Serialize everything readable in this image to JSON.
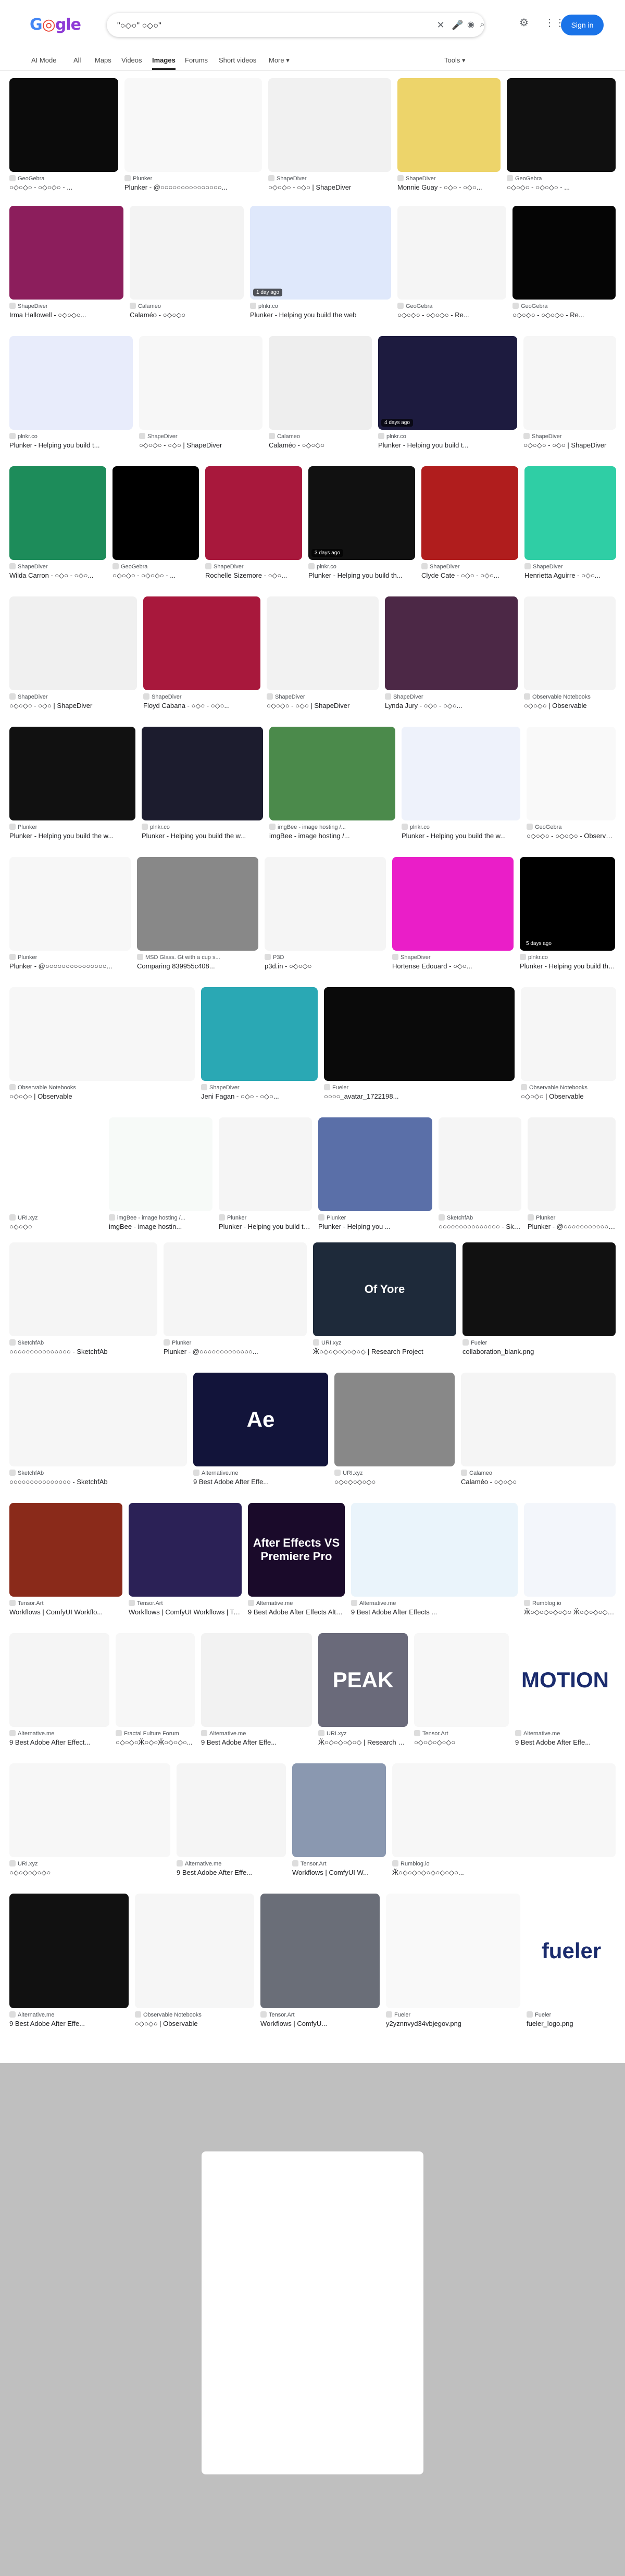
{
  "header": {
    "logo": "Google",
    "query": "\"○◇○\" ○◇○\"",
    "sign_in": "Sign in"
  },
  "tabs": [
    {
      "label": "AI Mode"
    },
    {
      "label": "All"
    },
    {
      "label": "Maps"
    },
    {
      "label": "Videos"
    },
    {
      "label": "Images",
      "active": true
    },
    {
      "label": "Forums"
    },
    {
      "label": "Short videos"
    },
    {
      "label": "More ▾"
    }
  ],
  "tools_label": "Tools ▾",
  "colors": {
    "accent": "#1a73e8",
    "magenta": "#ea1ec8",
    "crimson": "#a8183c",
    "teal": "#2fcea5",
    "dark": "#0b0b0b",
    "plum": "#4c2846",
    "yellow": "#edd46a"
  },
  "results": [
    {
      "src": "GeoGebra",
      "title": "○◇○◇○ - ○◇○◇○ - ..."
    },
    {
      "src": "Plunker",
      "title": "Plunker - @○○○○○○○○○○○○○○○..."
    },
    {
      "src": "ShapeDiver",
      "title": "○◇○◇○ - ○◇○ | ShapeDiver"
    },
    {
      "src": "ShapeDiver",
      "title": "Monnie Guay - ○◇○ - ○◇○..."
    },
    {
      "src": "GeoGebra",
      "title": "○◇○◇○ - ○◇○◇○ - ..."
    },
    {
      "src": "ShapeDiver",
      "title": "Irma Hallowell - ○◇○◇○..."
    },
    {
      "src": "Calameo",
      "title": "Calaméo - ○◇○◇○"
    },
    {
      "src": "plnkr.co",
      "title": "Plunker - Helping you build the web",
      "badge": "1 day ago"
    },
    {
      "src": "GeoGebra",
      "title": "○◇○◇○ - ○◇○◇○ - Re..."
    },
    {
      "src": "GeoGebra",
      "title": "○◇○◇○ - ○◇○◇○ - Re..."
    },
    {
      "src": "plnkr.co",
      "title": "Plunker - Helping you build t..."
    },
    {
      "src": "ShapeDiver",
      "title": "○◇○◇○ - ○◇○ | ShapeDiver"
    },
    {
      "src": "Calameo",
      "title": "Calaméo - ○◇○◇○"
    },
    {
      "src": "plnkr.co",
      "title": "Plunker - Helping you build t...",
      "badge": "4 days ago"
    },
    {
      "src": "ShapeDiver",
      "title": "○◇○◇○ - ○◇○ | ShapeDiver"
    },
    {
      "src": "ShapeDiver",
      "title": "Wilda Carron - ○◇○ - ○◇○..."
    },
    {
      "src": "GeoGebra",
      "title": "○◇○◇○ - ○◇○◇○ - ..."
    },
    {
      "src": "ShapeDiver",
      "title": "Rochelle Sizemore - ○◇○..."
    },
    {
      "src": "plnkr.co",
      "title": "Plunker - Helping you build th...",
      "badge": "3 days ago"
    },
    {
      "src": "ShapeDiver",
      "title": "Clyde Cate - ○◇○ - ○◇○..."
    },
    {
      "src": "ShapeDiver",
      "title": "Henrietta Aguirre - ○◇○..."
    },
    {
      "src": "ShapeDiver",
      "title": "○◇○◇○ - ○◇○ | ShapeDiver"
    },
    {
      "src": "ShapeDiver",
      "title": "Floyd Cabana - ○◇○ - ○◇○..."
    },
    {
      "src": "ShapeDiver",
      "title": "○◇○◇○ - ○◇○ | ShapeDiver"
    },
    {
      "src": "ShapeDiver",
      "title": "Lynda Jury - ○◇○ - ○◇○..."
    },
    {
      "src": "Observable Notebooks",
      "title": "○◇○◇○ | Observable"
    },
    {
      "src": "Plunker",
      "title": "Plunker - Helping you build the w..."
    },
    {
      "src": "plnkr.co",
      "title": "Plunker - Helping you build the w..."
    },
    {
      "src": "imgBee - image hosting /...",
      "title": "imgBee - image hosting /..."
    },
    {
      "src": "plnkr.co",
      "title": "Plunker - Helping you build the w..."
    },
    {
      "src": "GeoGebra",
      "title": "○◇○◇○ - ○◇○◇○ - Observable"
    },
    {
      "src": "Plunker",
      "title": "Plunker - @○○○○○○○○○○○○○○○..."
    },
    {
      "src": "MSD Glass. Gt with a cup s...",
      "title": "Comparing 839955c408..."
    },
    {
      "src": "P3D",
      "title": "p3d.in - ○◇○◇○"
    },
    {
      "src": "ShapeDiver",
      "title": "Hortense Edouard - ○◇○..."
    },
    {
      "src": "plnkr.co",
      "title": "Plunker - Helping you build the web",
      "badge": "5 days ago"
    },
    {
      "src": "Observable Notebooks",
      "title": "○◇○◇○ | Observable"
    },
    {
      "src": "ShapeDiver",
      "title": "Jeni Fagan - ○◇○ - ○◇○..."
    },
    {
      "src": "Fueler",
      "title": "○○○○_avatar_1722198..."
    },
    {
      "src": "Observable Notebooks",
      "title": "○◇○◇○ | Observable"
    },
    {
      "src": "URI.xyz",
      "title": "○◇○◇○"
    },
    {
      "src": "imgBee - image hosting /...",
      "title": "imgBee - image hostin..."
    },
    {
      "src": "Plunker",
      "title": "Plunker - Helping you build the ..."
    },
    {
      "src": "Plunker",
      "title": "Plunker - Helping you ..."
    },
    {
      "src": "SketchfAb",
      "title": "○○○○○○○○○○○○○○○ - SketchfAb"
    },
    {
      "src": "Plunker",
      "title": "Plunker - @○○○○○○○○○○○○○..."
    },
    {
      "src": "SketchfAb",
      "title": "○○○○○○○○○○○○○○○ - SketchfAb"
    },
    {
      "src": "Plunker",
      "title": "Plunker - @○○○○○○○○○○○○○..."
    },
    {
      "src": "URI.xyz",
      "title": "Ӂ○◇○◇○◇○◇○◇ | Research Project",
      "text": "Of Yore"
    },
    {
      "src": "Fueler",
      "title": "collaboration_blank.png"
    },
    {
      "src": "SketchfAb",
      "title": "○○○○○○○○○○○○○○○ - SketchfAb"
    },
    {
      "src": "Alternative.me",
      "title": "9 Best Adobe After Effe...",
      "text": "Ae"
    },
    {
      "src": "URI.xyz",
      "title": "○◇○◇○◇○◇○"
    },
    {
      "src": "Calameo",
      "title": "Calaméo - ○◇○◇○"
    },
    {
      "src": "Tensor.Art",
      "title": "Workflows | ComfyUI Workflo..."
    },
    {
      "src": "Tensor.Art",
      "title": "Workflows | ComfyUI Workflows | Tensor.Art"
    },
    {
      "src": "Alternative.me",
      "title": "9 Best Adobe After Effects Alternatives - R...",
      "text": "After Effects VS Premiere Pro"
    },
    {
      "src": "Alternative.me",
      "title": "9 Best Adobe After Effects ..."
    },
    {
      "src": "Rumblog.io",
      "title": "Ӂ○◇○◇○◇○◇○ Ӂ○◇○◇○◇○◇○◇○..."
    },
    {
      "src": "Alternative.me",
      "title": "9 Best Adobe After Effect..."
    },
    {
      "src": "Fractal Fulture Forum",
      "title": "○◇○◇○Ӂ○◇○Ӂ○◇○◇○..."
    },
    {
      "src": "Alternative.me",
      "title": "9 Best Adobe After Effe..."
    },
    {
      "src": "URI.xyz",
      "title": "Ӂ○◇○◇○◇○◇ | Research Pr...",
      "text": "PEAK"
    },
    {
      "src": "Tensor.Art",
      "title": "○◇○◇○◇○◇○"
    },
    {
      "src": "Alternative.me",
      "title": "9 Best Adobe After Effe...",
      "text": "MOTION"
    },
    {
      "src": "URI.xyz",
      "title": "○◇○◇○◇○◇○"
    },
    {
      "src": "Alternative.me",
      "title": "9 Best Adobe After Effe..."
    },
    {
      "src": "Tensor.Art",
      "title": "Workflows | ComfyUI W..."
    },
    {
      "src": "Rumblog.io",
      "title": "Ӂ○◇○◇○◇○◇○◇○◇○..."
    },
    {
      "src": "Alternative.me",
      "title": "9 Best Adobe After Effe..."
    },
    {
      "src": "Observable Notebooks",
      "title": "○◇○◇○ | Observable"
    },
    {
      "src": "Tensor.Art",
      "title": "Workflows | ComfyU..."
    },
    {
      "src": "Fueler",
      "title": "y2yznnvyd34vbjegov.png"
    },
    {
      "src": "Fueler",
      "title": "fueler_logo.png",
      "text": "fueler"
    }
  ]
}
